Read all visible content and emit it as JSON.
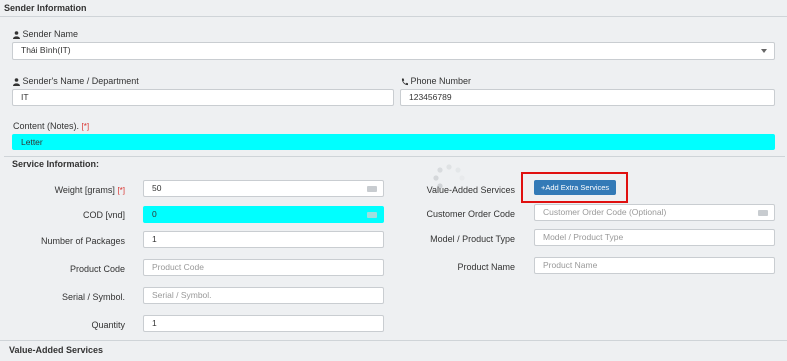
{
  "sender": {
    "section_title": "Sender Information",
    "name_label": "Sender Name",
    "name_value": "Thái Bình(IT)",
    "dept_label": "Sender's Name / Department",
    "dept_value": "IT",
    "phone_label": "Phone Number",
    "phone_value": "123456789",
    "content_label": "Content (Notes).",
    "content_value": "Letter",
    "required_mark": "[*]"
  },
  "service": {
    "section_title": "Service Information:",
    "weight_label": "Weight [grams]",
    "weight_value": "50",
    "cod_label": "COD [vnd]",
    "cod_value": "0",
    "packages_label": "Number of Packages",
    "packages_value": "1",
    "product_code_label": "Product Code",
    "product_code_placeholder": "Product Code",
    "serial_label": "Serial / Symbol.",
    "serial_placeholder": "Serial / Symbol.",
    "quantity_label": "Quantity",
    "quantity_value": "1",
    "vas_label": "Value-Added Services",
    "add_extra_label": "+Add Extra Services",
    "customer_order_label": "Customer Order Code",
    "customer_order_placeholder": "Customer Order Code (Optional)",
    "model_label": "Model / Product Type",
    "model_placeholder": "Model / Product Type",
    "product_name_label": "Product Name",
    "product_name_placeholder": "Product Name"
  },
  "footer": {
    "section_title": "Value-Added Services"
  },
  "colors": {
    "highlight": "#00ffff",
    "primary_button": "#337ab7",
    "callout_border": "#e01010",
    "required": "#d9302c"
  },
  "icons": [
    "user-icon",
    "phone-icon",
    "card-icon",
    "chevron-down-icon",
    "spinner-icon"
  ]
}
